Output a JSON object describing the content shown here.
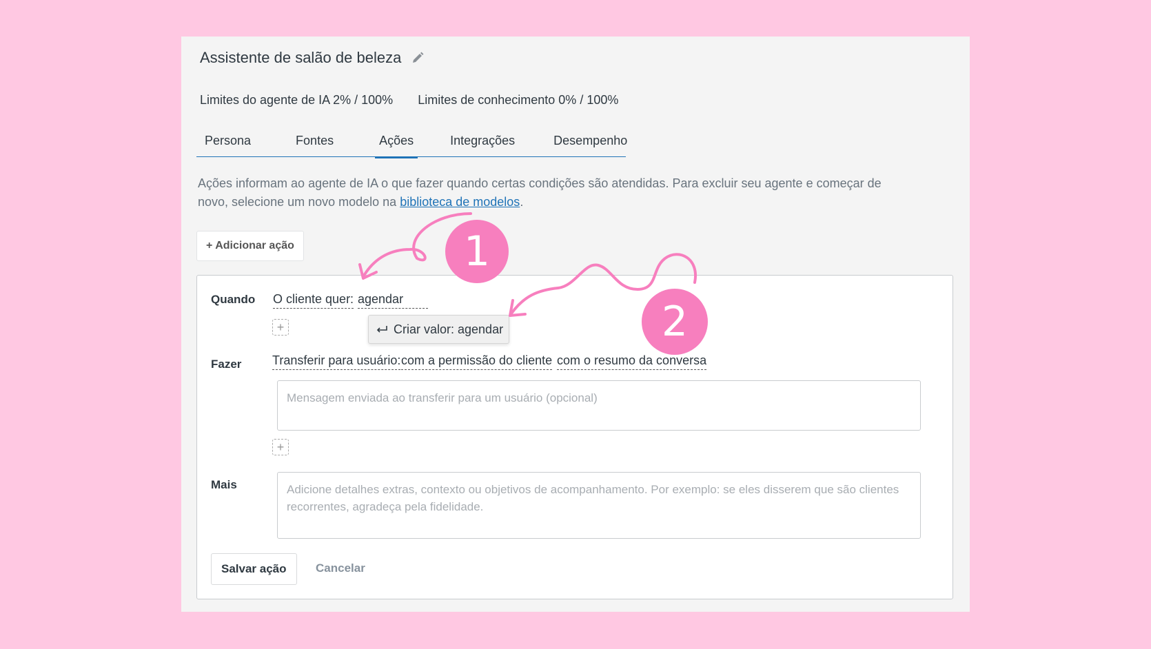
{
  "header": {
    "title": "Assistente de salão de beleza",
    "edit_icon": "pencil-icon",
    "ai_limits": "Limites do agente de IA 2% / 100%",
    "knowledge_limits": "Limites de conhecimento 0% / 100%"
  },
  "tabs": [
    {
      "label": "Persona"
    },
    {
      "label": "Fontes"
    },
    {
      "label": "Ações",
      "active": true
    },
    {
      "label": "Integrações"
    },
    {
      "label": "Desempenho"
    }
  ],
  "description": {
    "text": "Ações informam ao agente de IA o que fazer quando certas condições são atendidas. Para excluir seu agente e começar de novo, selecione um novo modelo na ",
    "link": "biblioteca de modelos",
    "suffix": "."
  },
  "add_action_label": "+ Adicionar ação",
  "action": {
    "when_label": "Quando",
    "condition_field": "O cliente quer:",
    "condition_value": "agendar",
    "dropdown_option": "Criar valor: agendar",
    "do_label": "Fazer",
    "do_field": "Transferir para usuário:",
    "do_option1": "com a permissão do cliente",
    "do_option2": "com o resumo da conversa",
    "transfer_message_placeholder": "Mensagem enviada ao transferir para um usuário (opcional)",
    "more_label": "Mais",
    "more_placeholder": "Adicione detalhes extras, contexto ou objetivos de acompanhamento. Por exemplo: se eles disserem que são clientes recorrentes, agradeça pela fidelidade.",
    "plus": "+"
  },
  "buttons": {
    "save": "Salvar ação",
    "cancel": "Cancelar"
  },
  "annotations": {
    "badge1": "1",
    "badge2": "2",
    "color": "#f77fbe"
  },
  "colors": {
    "background": "#ffc8e2",
    "accent": "#1f73b7"
  }
}
